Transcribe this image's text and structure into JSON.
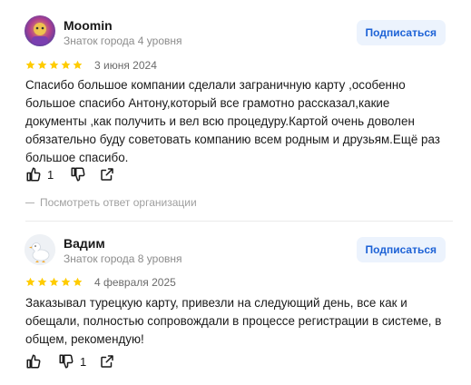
{
  "reviews": [
    {
      "author": "Moomin",
      "level": "Знаток города 4 уровня",
      "subscribe_label": "Подписаться",
      "rating": 5,
      "date": "3 июня 2024",
      "text": "Спасибо большое компании сделали заграничную карту ,особенно большое спасибо Антону,который все грамотно рассказал,какие документы ,как получить и вел всю процедуру.Картой очень доволен обязательно буду советовать компанию всем родным и друзьям.Ещё раз большое спасибо.",
      "likes": "1",
      "dislikes": "",
      "org_reply_label": "Посмотреть ответ организации"
    },
    {
      "author": "Вадим",
      "level": "Знаток города 8 уровня",
      "subscribe_label": "Подписаться",
      "rating": 5,
      "date": "4 февраля 2025",
      "text": "Заказывал турецкую карту, привезли на следующий день, все как и обещали, полностью сопровождали в процессе регистрации в системе, в общем, рекомендую!",
      "likes": "",
      "dislikes": "1"
    }
  ],
  "colors": {
    "star": "#fc0",
    "accent": "#1d62d6",
    "button_bg": "#ecf3fd"
  },
  "icons": [
    "thumb-up-icon",
    "thumb-down-icon",
    "share-icon",
    "star-icon"
  ]
}
